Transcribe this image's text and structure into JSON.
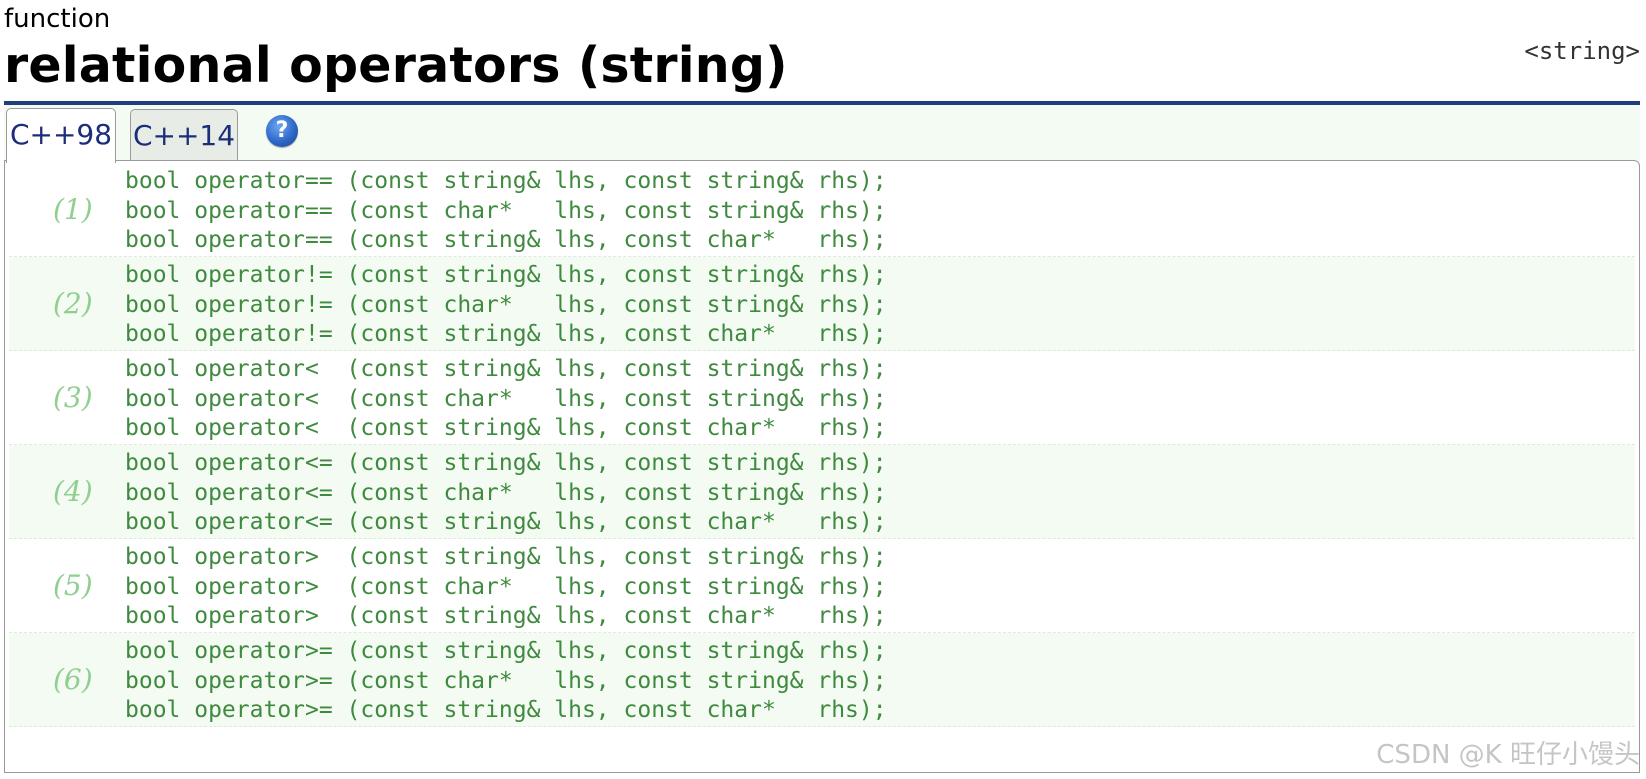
{
  "header": {
    "kind": "function",
    "title": "relational operators (string)",
    "header_link": "<string>"
  },
  "tabs": [
    {
      "label": "C++98",
      "active": true
    },
    {
      "label": "C++14",
      "active": false
    }
  ],
  "help_icon": {
    "icon": "help-icon",
    "glyph": "?"
  },
  "groups": [
    {
      "label": "(1)",
      "lines": [
        "bool operator== (const string& lhs, const string& rhs);",
        "bool operator== (const char*   lhs, const string& rhs);",
        "bool operator== (const string& lhs, const char*   rhs);"
      ]
    },
    {
      "label": "(2)",
      "lines": [
        "bool operator!= (const string& lhs, const string& rhs);",
        "bool operator!= (const char*   lhs, const string& rhs);",
        "bool operator!= (const string& lhs, const char*   rhs);"
      ]
    },
    {
      "label": "(3)",
      "lines": [
        "bool operator<  (const string& lhs, const string& rhs);",
        "bool operator<  (const char*   lhs, const string& rhs);",
        "bool operator<  (const string& lhs, const char*   rhs);"
      ]
    },
    {
      "label": "(4)",
      "lines": [
        "bool operator<= (const string& lhs, const string& rhs);",
        "bool operator<= (const char*   lhs, const string& rhs);",
        "bool operator<= (const string& lhs, const char*   rhs);"
      ]
    },
    {
      "label": "(5)",
      "lines": [
        "bool operator>  (const string& lhs, const string& rhs);",
        "bool operator>  (const char*   lhs, const string& rhs);",
        "bool operator>  (const string& lhs, const char*   rhs);"
      ]
    },
    {
      "label": "(6)",
      "lines": [
        "bool operator>= (const string& lhs, const string& rhs);",
        "bool operator>= (const char*   lhs, const string& rhs);",
        "bool operator>= (const string& lhs, const char*   rhs);"
      ]
    }
  ],
  "watermark": "CSDN @K 旺仔小馒头",
  "colors": {
    "rule": "#1f3f7a",
    "tab_text": "#1c2d7a",
    "code_text": "#3f8a3f",
    "label_text": "#8fcf8f",
    "shade": "#f3fbf3"
  }
}
